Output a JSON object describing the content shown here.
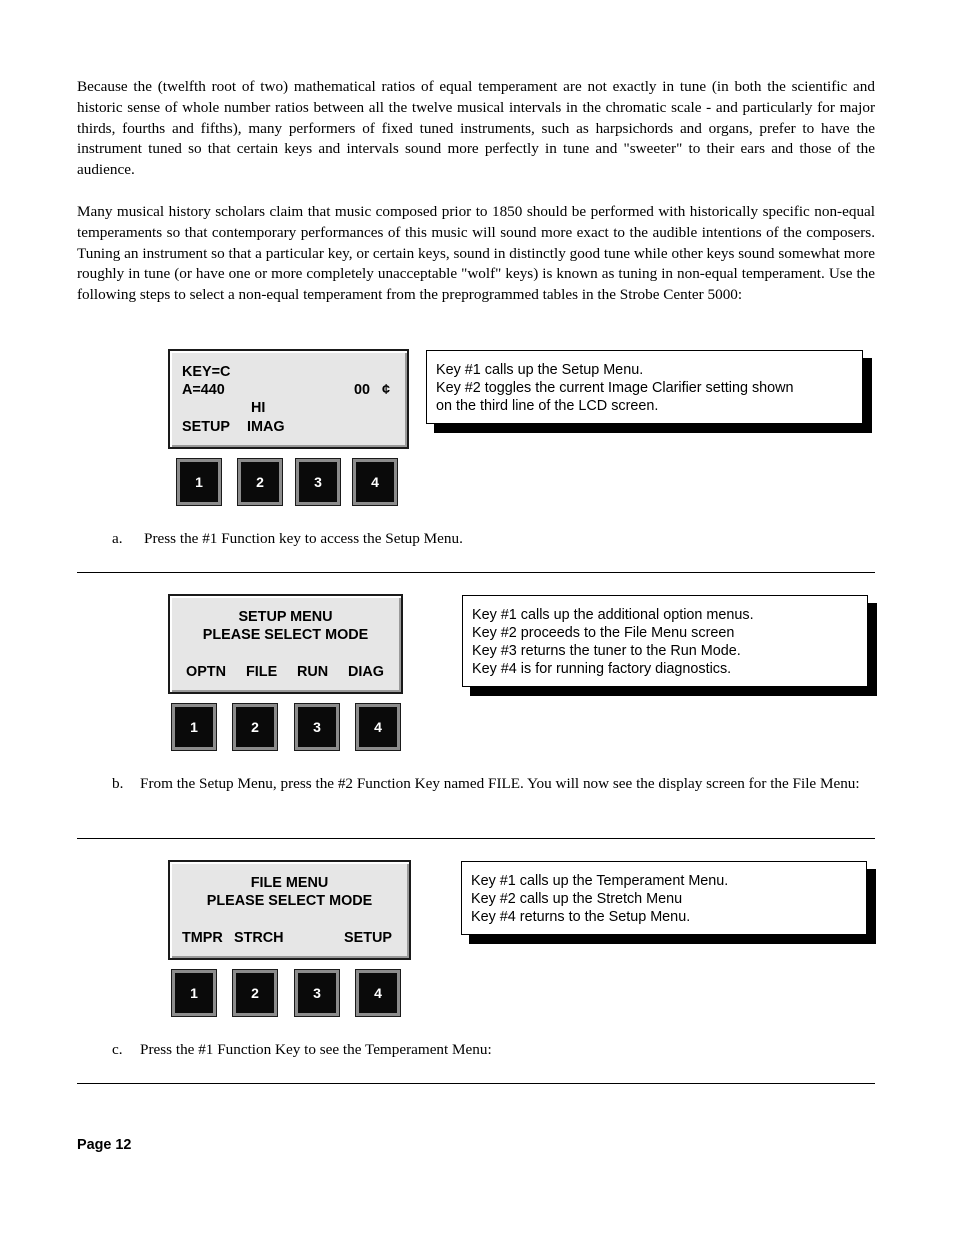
{
  "paragraphs": [
    "Because the (twelfth root of two) mathematical ratios of equal temperament are not exactly in tune (in both the scientific and historic sense of whole number ratios between all the twelve musical intervals in the chromatic scale - and particularly for major thirds, fourths and fifths), many performers of fixed tuned instruments, such as harpsichords and organs, prefer to have the instrument tuned so that certain keys and intervals sound more perfectly in tune and \"sweeter\" to their ears and those of the audience.",
    "Many musical history scholars claim that music composed prior to 1850 should be performed with historically specific non-equal temperaments so that contemporary performances of this music will sound more exact to the audible intentions of the composers.  Tuning an instrument so that a particular key, or certain keys, sound in distinctly good tune while other keys sound somewhat more roughly in tune (or have one or more completely unacceptable \"wolf\" keys) is known as tuning in non-equal temperament.  Use the following steps to select a non-equal temperament from the preprogrammed tables in the Strobe Center 5000:"
  ],
  "figures": [
    {
      "lcd": {
        "line1": "KEY=C",
        "line2_left": "A=440",
        "line2_right": "00   ¢",
        "line3": "HI",
        "line4_left": "SETUP",
        "line4_mid": "IMAG"
      },
      "keys": [
        "1",
        "2",
        "3",
        "4"
      ],
      "callout": [
        "Key #1 calls up the Setup Menu.",
        "Key #2 toggles the current Image Clarifier setting shown",
        "on the third line of the LCD screen."
      ],
      "step": {
        "marker": "a.",
        "text": "Press the #1 Function key to access the Setup Menu."
      }
    },
    {
      "lcd": {
        "line1": "SETUP MENU",
        "line2": "PLEASE SELECT MODE",
        "softkeys": [
          "OPTN",
          "FILE",
          "RUN",
          "DIAG"
        ]
      },
      "keys": [
        "1",
        "2",
        "3",
        "4"
      ],
      "callout": [
        "Key #1 calls up the additional option menus.",
        "Key #2 proceeds to the File Menu screen",
        "Key #3 returns the tuner to the Run Mode.",
        "Key #4 is for running factory diagnostics."
      ],
      "step": {
        "marker": "b.",
        "text": "From the Setup Menu, press the #2 Function Key named FILE.  You will now see the display screen for the File Menu:"
      }
    },
    {
      "lcd": {
        "line1": "FILE MENU",
        "line2": "PLEASE SELECT MODE",
        "softkeys": [
          "TMPR",
          "STRCH",
          "",
          "SETUP"
        ]
      },
      "keys": [
        "1",
        "2",
        "3",
        "4"
      ],
      "callout": [
        "Key #1 calls up the Temperament Menu.",
        "Key #2 calls up the Stretch Menu",
        "Key #4 returns to the Setup Menu."
      ],
      "step": {
        "marker": "c.",
        "text": "Press the #1 Function Key to see the Temperament Menu:"
      }
    }
  ],
  "footer": {
    "page_label": "Page 12"
  }
}
